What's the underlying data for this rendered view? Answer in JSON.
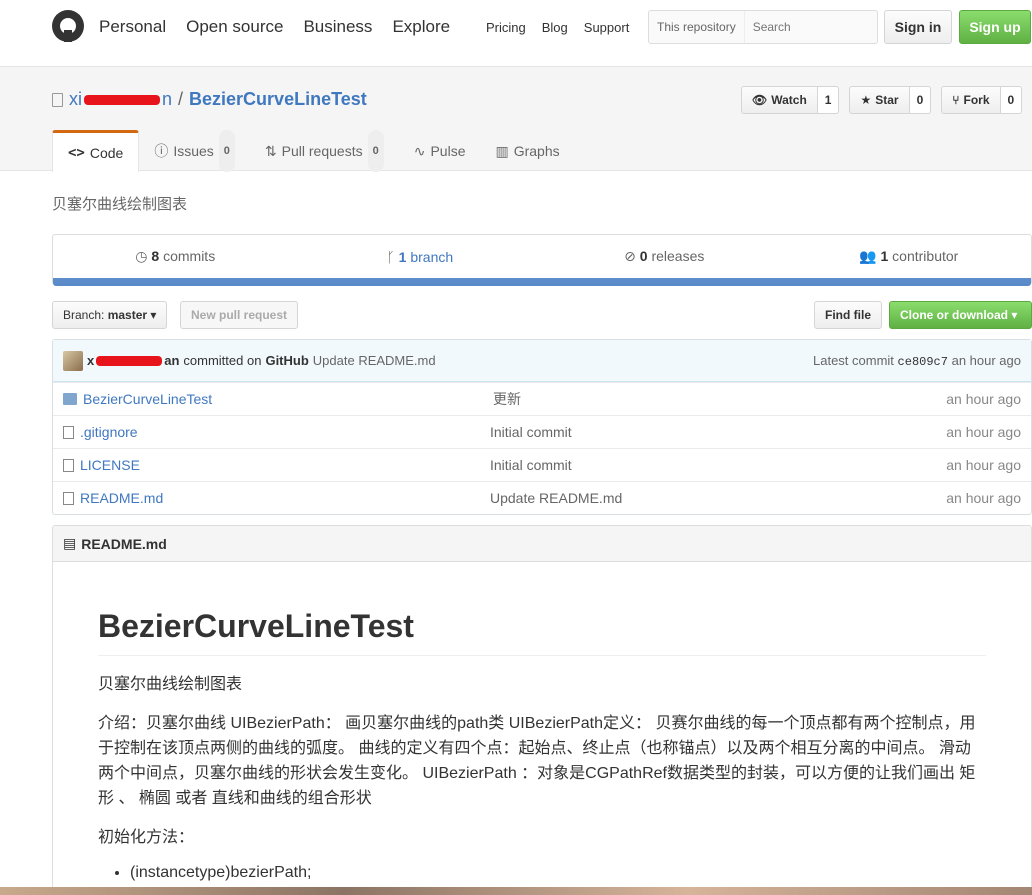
{
  "header": {
    "nav": [
      "Personal",
      "Open source",
      "Business",
      "Explore"
    ],
    "subnav": [
      "Pricing",
      "Blog",
      "Support"
    ],
    "search_scope": "This repository",
    "search_placeholder": "Search",
    "signin_label": "Sign in",
    "signup_label": "Sign up"
  },
  "repo": {
    "owner_prefix": "xi",
    "owner_suffix": "n",
    "separator": "/",
    "name": "BezierCurveLineTest",
    "watch": {
      "label": "Watch",
      "count": "1"
    },
    "star": {
      "label": "Star",
      "count": "0"
    },
    "fork": {
      "label": "Fork",
      "count": "0"
    },
    "tabs": [
      {
        "label": "Code",
        "count": ""
      },
      {
        "label": "Issues",
        "count": "0"
      },
      {
        "label": "Pull requests",
        "count": "0"
      },
      {
        "label": "Pulse",
        "count": ""
      },
      {
        "label": "Graphs",
        "count": ""
      }
    ],
    "description": "贝塞尔曲线绘制图表"
  },
  "summary": {
    "commits": {
      "count": "8",
      "label": "commits"
    },
    "branches": {
      "count": "1",
      "label": "branch"
    },
    "releases": {
      "count": "0",
      "label": "releases"
    },
    "contributors": {
      "count": "1",
      "label": "contributor"
    }
  },
  "filebar": {
    "branch_label": "Branch:",
    "branch_name": "master",
    "new_pr": "New pull request",
    "find_file": "Find file",
    "clone": "Clone or download"
  },
  "commit": {
    "author_prefix": "x",
    "author_suffix": "an",
    "committed_on": "committed on",
    "platform": "GitHub",
    "message": "Update README.md",
    "latest_label": "Latest commit",
    "sha": "ce809c7",
    "age": "an hour ago"
  },
  "files": [
    {
      "name": "BezierCurveLineTest",
      "type": "folder",
      "message": "更新",
      "age": "an hour ago"
    },
    {
      "name": ".gitignore",
      "type": "file",
      "message": "Initial commit",
      "age": "an hour ago"
    },
    {
      "name": "LICENSE",
      "type": "file",
      "message": "Initial commit",
      "age": "an hour ago"
    },
    {
      "name": "README.md",
      "type": "file",
      "message": "Update README.md",
      "age": "an hour ago"
    }
  ],
  "readme": {
    "header": "README.md",
    "title": "BezierCurveLineTest",
    "subtitle": "贝塞尔曲线绘制图表",
    "intro": "介绍：贝塞尔曲线 UIBezierPath： 画贝塞尔曲线的path类 UIBezierPath定义： 贝赛尔曲线的每一个顶点都有两个控制点，用于控制在该顶点两侧的曲线的弧度。 曲线的定义有四个点：起始点、终止点（也称锚点）以及两个相互分离的中间点。 滑动两个中间点，贝塞尔曲线的形状会发生变化。 UIBezierPath ：对象是CGPathRef数据类型的封装，可以方便的让我们画出 矩形 、 椭圆 或者 直线和曲线的组合形状",
    "init_label": "初始化方法：",
    "list": [
      "(instancetype)bezierPath;"
    ]
  }
}
